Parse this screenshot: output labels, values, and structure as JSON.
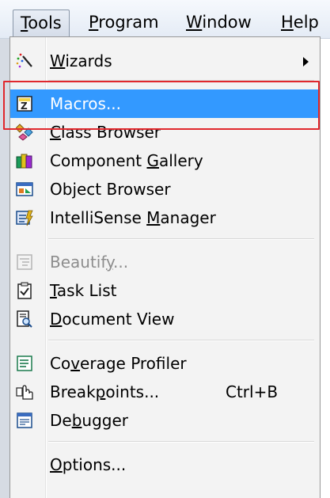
{
  "menubar": {
    "items": [
      {
        "label": "Tools",
        "mnemonic": "T",
        "active": true
      },
      {
        "label": "Program",
        "mnemonic": "P",
        "active": false
      },
      {
        "label": "Window",
        "mnemonic": "W",
        "active": false
      },
      {
        "label": "Help",
        "mnemonic": "H",
        "active": false
      }
    ]
  },
  "menu": {
    "items": [
      {
        "label": "Wizards",
        "icon": "wizard-wand-icon",
        "submenu": true
      },
      {
        "label": "Macros...",
        "icon": "macros-icon",
        "highlighted": true
      },
      {
        "label": "Class Browser",
        "icon": "class-browser-icon"
      },
      {
        "label": "Component Gallery",
        "icon": "component-gallery-icon"
      },
      {
        "label": "Object Browser",
        "icon": "object-browser-icon"
      },
      {
        "label": "IntelliSense Manager",
        "icon": "intellisense-icon"
      },
      {
        "label": "Beautify...",
        "icon": "beautify-icon",
        "disabled": true
      },
      {
        "label": "Task List",
        "icon": "task-list-icon"
      },
      {
        "label": "Document View",
        "icon": "document-view-icon"
      },
      {
        "label": "Coverage Profiler",
        "icon": "coverage-profiler-icon"
      },
      {
        "label": "Breakpoints...",
        "icon": "breakpoints-icon",
        "shortcut": "Ctrl+B"
      },
      {
        "label": "Debugger",
        "icon": "debugger-icon"
      },
      {
        "label": "Options...",
        "icon": ""
      }
    ]
  },
  "colors": {
    "highlight": "#3399ff",
    "annotation_box": "#e0282d",
    "menu_background": "#f3f3f3"
  }
}
